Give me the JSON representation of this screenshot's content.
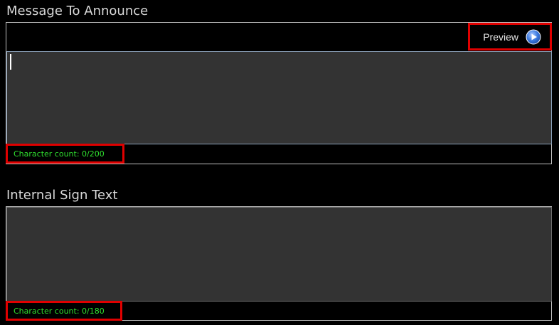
{
  "message_section": {
    "title": "Message To Announce",
    "preview_label": "Preview",
    "textarea_value": "",
    "char_count_text": "Character count: 0/200"
  },
  "sign_section": {
    "title": "Internal Sign Text",
    "textarea_value": "",
    "char_count_text": "Character count: 0/180"
  },
  "icons": {
    "preview": "play-circle-icon"
  },
  "colors": {
    "background": "#000000",
    "textarea_bg": "#333333",
    "count_text": "#2fe02f",
    "highlight_border": "#e00000",
    "icon_blue": "#3d7be0"
  }
}
